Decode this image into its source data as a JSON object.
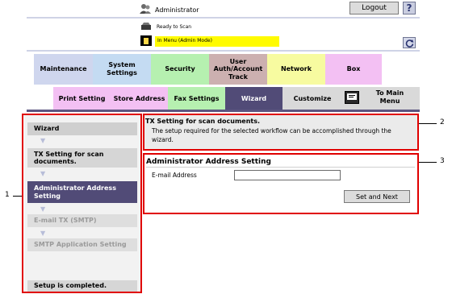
{
  "header": {
    "user_label": "Administrator",
    "logout_label": "Logout",
    "help_label": "?",
    "status_text": "Ready to Scan",
    "mode_text": "In Menu (Admin Mode)"
  },
  "main_tabs": [
    {
      "label": "Maintenance"
    },
    {
      "label": "System\nSettings"
    },
    {
      "label": "Security"
    },
    {
      "label": "User\nAuth/Account\nTrack"
    },
    {
      "label": "Network"
    },
    {
      "label": "Box"
    }
  ],
  "sub_tabs": [
    {
      "label": "Print Setting"
    },
    {
      "label": "Store Address"
    },
    {
      "label": "Fax Settings"
    },
    {
      "label": "Wizard"
    },
    {
      "label": "Customize"
    }
  ],
  "main_menu_label": "To Main\nMenu",
  "wizard": {
    "title": "Wizard",
    "steps": [
      {
        "label": "TX Setting for scan\ndocuments."
      },
      {
        "label": "Administrator Address\nSetting"
      },
      {
        "label": "E-mail TX (SMTP)"
      },
      {
        "label": "SMTP Application Setting"
      }
    ],
    "complete_label": "Setup is completed."
  },
  "info": {
    "title": "TX Setting for scan documents.",
    "description": "The setup required for the selected workflow can be accomplished through the wizard."
  },
  "address_setting": {
    "title": "Administrator Address Setting",
    "email_label": "E-mail Address",
    "email_value": "",
    "button_label": "Set and Next"
  },
  "callouts": [
    "1",
    "2",
    "3"
  ],
  "colors": {
    "active_dark": "#514b77",
    "highlight_red": "#e00000",
    "mode_yellow": "#fffb00",
    "tab_maintenance": "#cfd6ee",
    "tab_system": "#c4dbf2",
    "tab_security": "#b6f0b0",
    "tab_user": "#ccb0b0",
    "tab_network": "#f7fba0",
    "tab_box": "#f3c0f3"
  }
}
